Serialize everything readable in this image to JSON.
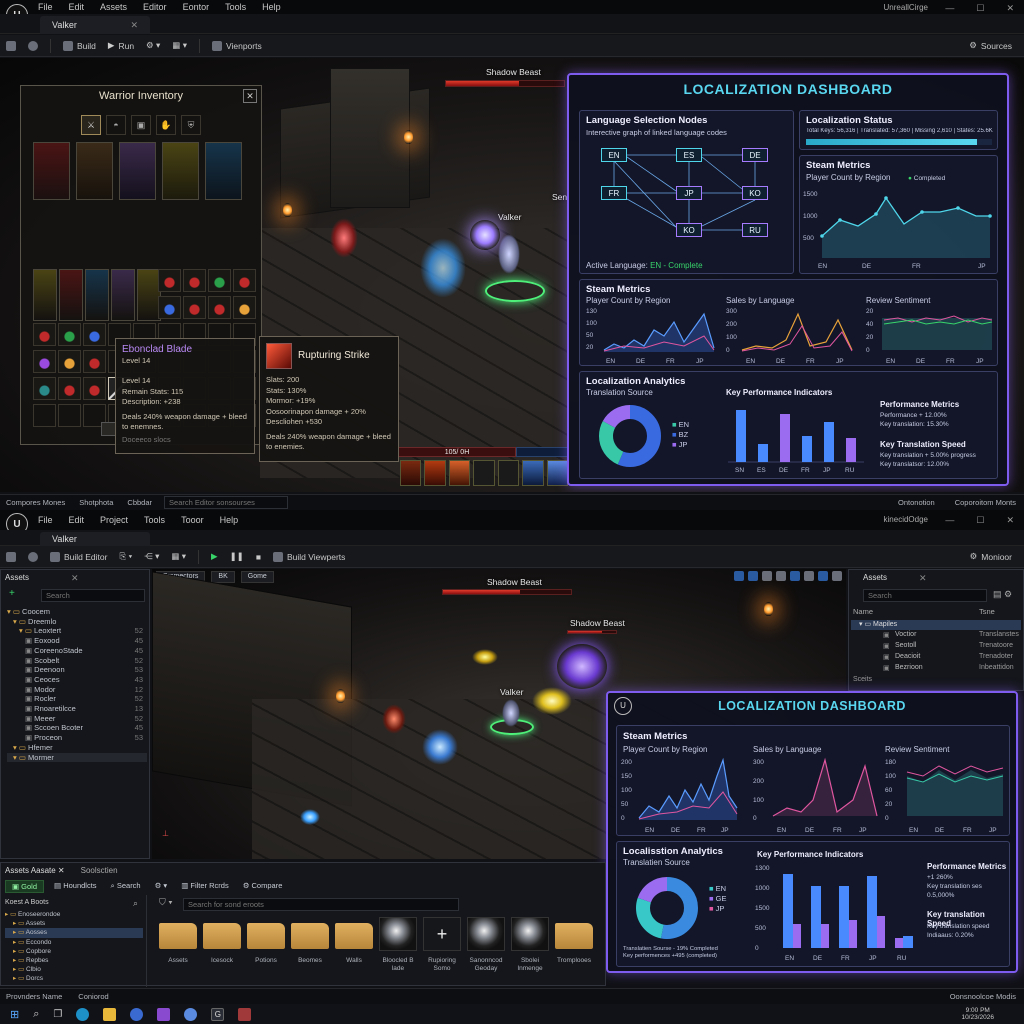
{
  "top": {
    "logo": "U",
    "menu": [
      "File",
      "Edit",
      "Assets",
      "Editor",
      "Eontor",
      "Tools",
      "Help"
    ],
    "tab": "Valker",
    "app_name": "UnreallCirge",
    "toolbar": {
      "build": "Build",
      "run": "Run",
      "viewports": "Vienports",
      "sources": "Sources"
    },
    "boss_name": "Shadow Beast",
    "player_name": "Valker",
    "side_label": "Sen",
    "hp_text": "105/ 0H",
    "inventory": {
      "title": "Warrior Inventory",
      "close": "✕"
    },
    "tooltip_item": {
      "name": "Ebonclad Blade",
      "level_tag": "Level 14",
      "lines": [
        "Level 14",
        "Remain Stats: 115",
        "Description: +238"
      ],
      "desc": "Deals 240% weapon damage + bleed to enemnes.",
      "footer": "Doceeco slocs"
    },
    "tooltip_skill": {
      "name": "Rupturing Strike",
      "lines": [
        "Slats: 200",
        "Stats: 130%",
        "Mormor: +19%",
        "Oosoorinapon damage + 20%",
        "Descliohen +530"
      ],
      "desc": "Deals 240% weapon damage + bleed to enemies."
    },
    "dashboard": {
      "title": "LOCALIZATION DASHBOARD",
      "lang_title": "Language Selection Nodes",
      "lang_sub": "Interective graph of linked language codes",
      "nodes": [
        "EN",
        "ES",
        "DE",
        "FR",
        "JP",
        "KO",
        "KO",
        "RU"
      ],
      "active_lang": "Active Language:",
      "active_value": "EN - Complete",
      "status_title": "Localization Status",
      "status_text": "Total Keys: 56,316 | Translated: 57,360 | Missing 2,610 | States: 25.6K",
      "steam_title": "Steam Metrics",
      "steam_sub": "Player Count by Region",
      "steam_legend": "Completed",
      "steam_yticks": [
        "1500",
        "1000",
        "500"
      ],
      "steam_xticks": [
        "EN",
        "DE",
        "FR",
        "JP"
      ],
      "row2": {
        "steam_title": "Steam Metrics",
        "player_title": "Player Count by Region",
        "player_yticks": [
          "130",
          "100",
          "50",
          "20"
        ],
        "sales_title": "Sales by Language",
        "sales_yticks": [
          "300",
          "200",
          "100",
          "0"
        ],
        "review_title": "Review Sentiment",
        "review_yticks": [
          "20",
          "40",
          "20",
          "0"
        ],
        "xticks": [
          "EN",
          "DE",
          "FR",
          "JP"
        ]
      },
      "analytics": {
        "title": "Localization Analytics",
        "source": "Translation Source",
        "legend": [
          "EN",
          "BZ",
          "JP"
        ],
        "kpi_title": "Key Performance Indicators",
        "kpi_x": [
          "SN",
          "ES",
          "DE",
          "FR",
          "JP",
          "RU"
        ],
        "perf_title": "Performance Metrics",
        "perf_lines": [
          "Performance + 12.00%",
          "Key translation: 15.30%"
        ],
        "speed_title": "Key Translation Speed",
        "speed_lines": [
          "Key translation + 5.00% progress",
          "Key translatsor: 12.00%"
        ]
      }
    },
    "status": {
      "left": [
        "Compores Mones",
        "Shotphota",
        "Cbbdar"
      ],
      "search": "Search Editor sonsourses",
      "right": [
        "Ontonotion",
        "Coporoitom Monts"
      ]
    }
  },
  "bottom": {
    "logo": "U",
    "menu": [
      "File",
      "Edit",
      "Project",
      "Tools",
      "Tooor",
      "Help"
    ],
    "tab": "Valker",
    "app_name": "kinecidOdge",
    "toolbar": {
      "build": "Build Editor",
      "build_viewports": "Build Viewperts",
      "monitor": "Monioor"
    },
    "assets_panel": {
      "title": "Assets",
      "search": "Search",
      "tree": [
        "Coocem",
        "Dreemlo",
        "Leoxtert",
        "Eoxood",
        "CoreenoStade",
        "Scobelt",
        "Deenoon",
        "Ceoces",
        "Modor",
        "Rocler",
        "Rnoaretilcce",
        "Meeer",
        "Sccoen Bcoter",
        "Proceon",
        "Hfemer",
        "Mormer"
      ],
      "tree_nums": [
        "52",
        "45",
        "45",
        "52",
        "53",
        "43",
        "12",
        "52",
        "13",
        "52",
        "45",
        "53"
      ]
    },
    "viewport_chips": [
      "Fromectors",
      "BK",
      "Gome"
    ],
    "boss_name": "Shadow Beast",
    "boss2_name": "Shadow Beast",
    "player_name": "Valker",
    "right_panel": {
      "title": "Assets",
      "search": "Search",
      "name_col": "Name",
      "type_col": "Tsne",
      "folder": "Mapiles",
      "rows": [
        [
          "Voctior",
          "Translanstes"
        ],
        [
          "Seotoll",
          "Trenatoore"
        ],
        [
          "Deacioit",
          "Trenadoter"
        ],
        [
          "Bezrioon",
          "Inbeattidon"
        ]
      ],
      "footer": "Sceits"
    },
    "dashboard": {
      "title": "LOCALIZATION DASHBOARD",
      "steam_title": "Steam Metrics",
      "player_title": "Player Count by Region",
      "player_yticks": [
        "200",
        "150",
        "100",
        "50",
        "0"
      ],
      "sales_title": "Sales by Language",
      "sales_yticks": [
        "300",
        "200",
        "100",
        "0"
      ],
      "review_title": "Review Sentiment",
      "review_yticks": [
        "180",
        "100",
        "60",
        "20",
        "0"
      ],
      "xticks": [
        "EN",
        "DE",
        "FR",
        "JP"
      ],
      "analytics_title": "Localisstion Analytics",
      "source": "Translatien Source",
      "legend": [
        "EN",
        "GE",
        "JP"
      ],
      "source_note": "Translatien Sourse - 19% Completed",
      "source_note2": "Key performences +495 (completed)",
      "kpi_title": "Key Performance Indicators",
      "kpi_yticks": [
        "1300",
        "1000",
        "1500",
        "500",
        "0"
      ],
      "kpi_x": [
        "EN",
        "DE",
        "FR",
        "JP",
        "RU"
      ],
      "perf_title": "Performance Metrics",
      "perf_lines": [
        "+1 260%",
        "Key translation ses",
        "0.5,000%"
      ],
      "speed_title": "Key translation Speed",
      "speed_lines": [
        "Key translation speed",
        "Indiaaus: 0.20%"
      ]
    },
    "content": {
      "tab1": "Assets Aasate",
      "tab2": "Soolsctien",
      "btn_add": "Gold",
      "btn_hounds": "Houndlcts",
      "btn_search": "Search",
      "btn_filters": "Filter Rcrds",
      "btn_compare": "Compare",
      "search_ph": "Search for sond eroots",
      "tree_title": "Koest A Boots",
      "tree": [
        "Enoseerondoe",
        "Assets",
        "Aosses",
        "Eccondo",
        "Copbore",
        "Repbes",
        "Clbio",
        "Dorcs"
      ],
      "assets": [
        "Assets",
        "Icesock",
        "Potions",
        "Beomes",
        "Walls",
        "Bloocled B lade",
        "Rupioring Somo",
        "Sanonncod Geoday",
        "Sbolei Inmenge",
        "Tromplooes"
      ]
    },
    "status": {
      "left": [
        "Provnders Name",
        "Coniorod"
      ],
      "right": "Oonsnoolcoe Modis"
    },
    "taskbar_time": "9:00 PM",
    "taskbar_date": "10/23/2026"
  },
  "colors": {
    "accent": "#7e5cf0",
    "cyan": "#4fd6ea",
    "pink": "#e056a0",
    "gold": "#e8a23a",
    "green": "#38d46a"
  }
}
